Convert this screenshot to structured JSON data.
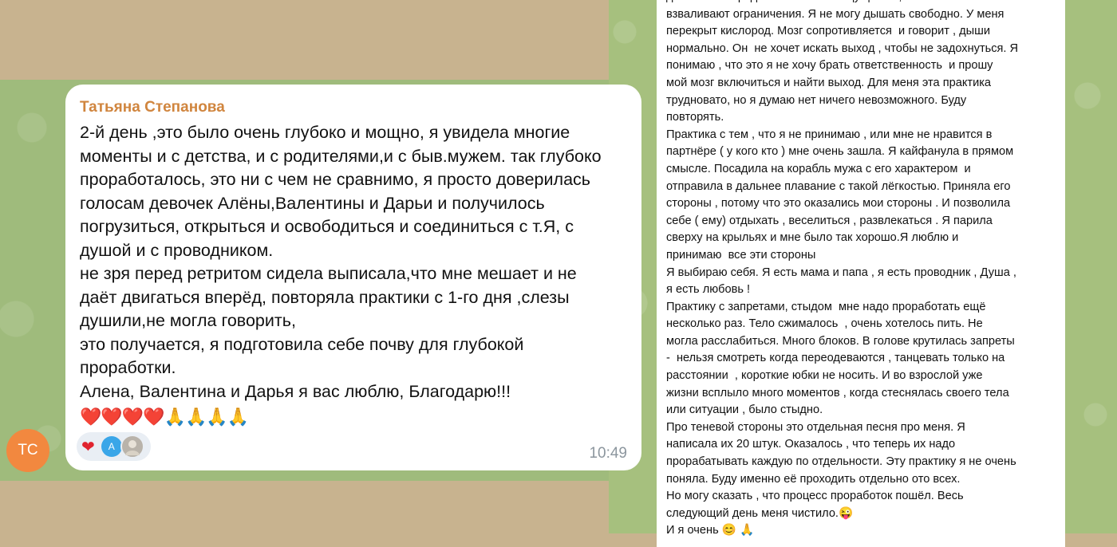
{
  "left_chat": {
    "sender": "Татьяна Степанова",
    "text": "2-й день ,это было очень глубоко и мощно, я увидела многие\nмоменты и с детства, и с родителями,и с быв.мужем. так глубоко\nпроработалось, это ни с чем не сравнимо, я просто доверилась\nголосам девочек Алёны,Валентины и Дарьи и получилось\nпогрузиться, открыться и освободиться и соединиться с т.Я, с\nдушой и с проводником.\nне зря перед ретритом сидела выписала,что мне мешает и не\nдаёт двигаться вперёд, повторяла практики с 1-го дня ,слезы\nдушили,не могла говорить,\nэто получается, я подготовила себе почву для глубокой\nпроработки.\nАлена, Валентина и Дарья я вас люблю, Благодарю!!!",
    "emojis": "❤️❤️❤️❤️🙏🙏🙏🙏",
    "reaction_emoji": "❤",
    "reactor_initial": "A",
    "time": "10:49",
    "avatar_initials": "TC",
    "colors": {
      "sender": "#d0853e",
      "avatar": "#f2883f",
      "reactor": "#3aa6e8"
    }
  },
  "right_chat": {
    "text": "для меня запредельное.  Было ощущение , что на меня опять\nвзваливают ограничения. Я не могу дышать свободно. У меня\nперекрыт кислород. Мозг сопротивляется  и говорит , дыши\nнормально. Он  не хочет искать выход , чтобы не задохнуться. Я\nпонимаю , что это я не хочу брать ответственность  и прошу\nмой мозг включиться и найти выход. Для меня эта практика\nтрудновато, но я думаю нет ничего невозможного. Буду\nповторять.\nПрактика с тем , что я не принимаю , или мне не нравится в\nпартнёре ( у кого кто ) мне очень зашла. Я кайфанула в прямом\nсмысле. Посадила на корабль мужа с его характером  и\nотправила в дальнее плавание с такой лёгкостью. Приняла его\nстороны , потому что это оказались мои стороны . И позволила\nсебе ( ему) отдыхать , веселиться , развлекаться . Я парила\nсверху на крыльях и мне было так хорошо.Я люблю и\nпринимаю  все эти стороны\nЯ выбираю себя. Я есть мама и папа , я есть проводник , Душа ,\nя есть любовь !\nПрактику с запретами, стыдом  мне надо проработать ещё\nнесколько раз. Тело сжималось  , очень хотелось пить. Не\nмогла расслабиться. Много блоков. В голове крутилась запреты\n-  нельзя смотреть когда переодеваются , танцевать только на\nрасстоянии  , короткие юбки не носить. И во взрослой уже\nжизни всплыло много моментов , когда стеснялась своего тела\nили ситуации , было стыдно.\nПро теневой стороны это отдельная песня про меня. Я\nнаписала их 20 штук. Оказалось , что теперь их надо\nпрорабатывать каждую по отдельности. Эту практику я не очень\nпоняла. Буду именно её проходить отдельно ото всех.\nНо могу сказать , что процесс проработок пошёл. Весь\nследующий день меня чистило.😜\nИ я очень 😊 🙏"
  }
}
